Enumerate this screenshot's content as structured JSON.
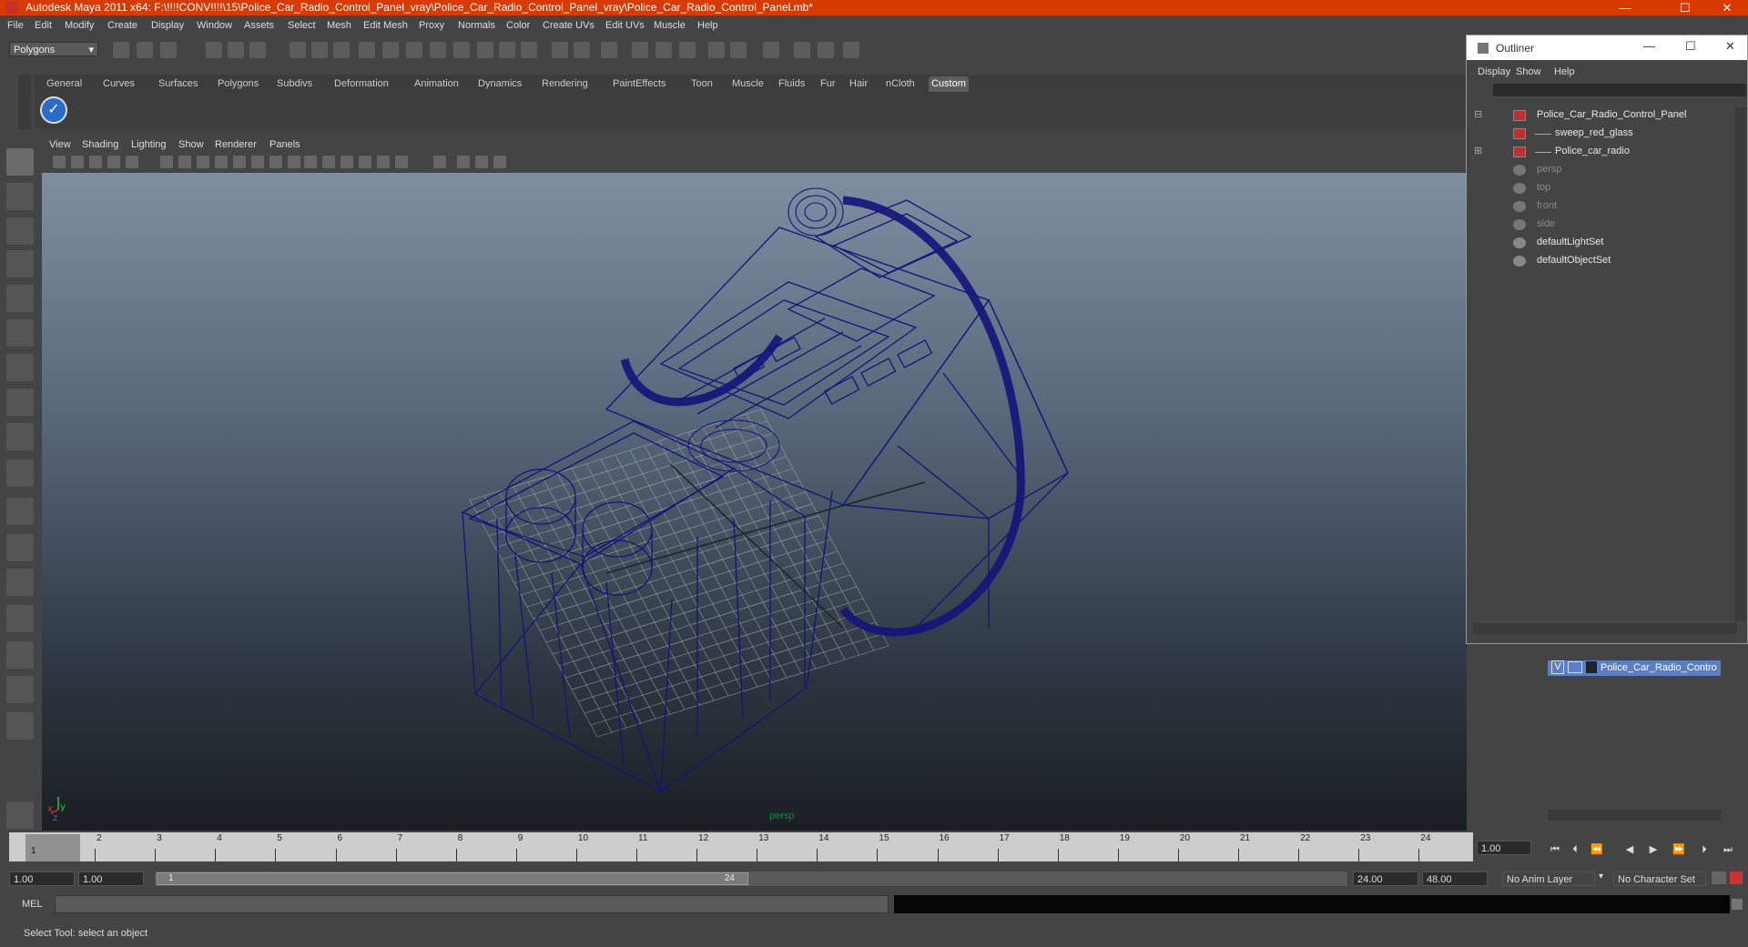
{
  "window": {
    "title": "Autodesk Maya 2011 x64: F:\\!!!!CONV!!!!\\15\\Police_Car_Radio_Control_Panel_vray\\Police_Car_Radio_Control_Panel_vray\\Police_Car_Radio_Control_Panel.mb*",
    "minimize": "—",
    "maximize": "☐",
    "close": "✕"
  },
  "menubar": [
    "File",
    "Edit",
    "Modify",
    "Create",
    "Display",
    "Window",
    "Assets",
    "Select",
    "Mesh",
    "Edit Mesh",
    "Proxy",
    "Normals",
    "Color",
    "Create UVs",
    "Edit UVs",
    "Muscle",
    "Help"
  ],
  "statusline": {
    "mode": "Polygons"
  },
  "shelf": {
    "tabs": [
      "General",
      "Curves",
      "Surfaces",
      "Polygons",
      "Subdivs",
      "Deformation",
      "Animation",
      "Dynamics",
      "Rendering",
      "PaintEffects",
      "Toon",
      "Muscle",
      "Fluids",
      "Fur",
      "Hair",
      "nCloth",
      "Custom"
    ],
    "active_tab": "Custom"
  },
  "viewport": {
    "menu": [
      "View",
      "Shading",
      "Lighting",
      "Show",
      "Renderer",
      "Panels"
    ],
    "camera_label": "persp",
    "wire_color": "#14147a"
  },
  "outliner": {
    "title": "Outliner",
    "menu": [
      "Display",
      "Show",
      "Help"
    ],
    "items": [
      {
        "label": "Police_Car_Radio_Control_Panel",
        "type": "mesh",
        "level": 0,
        "expander": "⊟",
        "dim": false
      },
      {
        "label": "sweep_red_glass",
        "type": "mesh",
        "level": 1,
        "expander": "",
        "dim": false
      },
      {
        "label": "Police_car_radio",
        "type": "mesh",
        "level": 1,
        "expander": "⊞",
        "dim": false
      },
      {
        "label": "persp",
        "type": "cam",
        "level": 0,
        "expander": "",
        "dim": true
      },
      {
        "label": "top",
        "type": "cam",
        "level": 0,
        "expander": "",
        "dim": true
      },
      {
        "label": "front",
        "type": "cam",
        "level": 0,
        "expander": "",
        "dim": true
      },
      {
        "label": "side",
        "type": "cam",
        "level": 0,
        "expander": "",
        "dim": true
      },
      {
        "label": "defaultLightSet",
        "type": "set",
        "level": 0,
        "expander": "",
        "dim": false
      },
      {
        "label": "defaultObjectSet",
        "type": "set",
        "level": 0,
        "expander": "",
        "dim": false
      }
    ]
  },
  "layers": {
    "row": {
      "visible": "V",
      "name": "Police_Car_Radio_Contro"
    }
  },
  "timeslider": {
    "ticks": [
      "1",
      "2",
      "3",
      "4",
      "5",
      "6",
      "7",
      "8",
      "9",
      "10",
      "11",
      "12",
      "13",
      "14",
      "15",
      "16",
      "17",
      "18",
      "19",
      "20",
      "21",
      "22",
      "23",
      "24"
    ],
    "current_frame": "1",
    "current_time": "1.00"
  },
  "range": {
    "start_time": "1.00",
    "start_range": "1.00",
    "handle_start": "1",
    "handle_end": "24",
    "end_range": "24.00",
    "end_time": "48.00",
    "anim_layer": "No Anim Layer",
    "char_set": "No Character Set"
  },
  "commandline": {
    "label": "MEL"
  },
  "helpline": {
    "text": "Select Tool: select an object"
  }
}
